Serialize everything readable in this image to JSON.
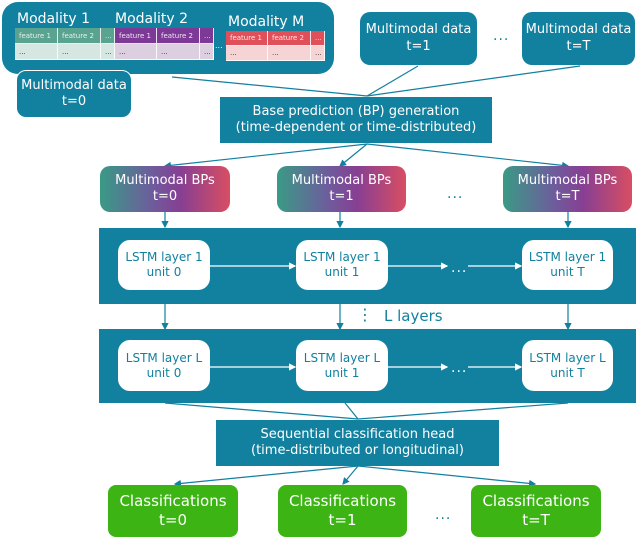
{
  "modality_panel": {
    "modalities": [
      {
        "title": "Modality 1",
        "features": [
          "feature 1",
          "feature 2",
          "..."
        ],
        "row": [
          "...",
          "...",
          "..."
        ],
        "color": "#5aa390"
      },
      {
        "title": "Modality 2",
        "features": [
          "feature 1",
          "feature 2",
          "..."
        ],
        "row": [
          "...",
          "...",
          "..."
        ],
        "color": "#7c3a96"
      },
      {
        "title": "Modality M",
        "features": [
          "feature 1",
          "feature 2",
          "..."
        ],
        "row": [
          "...",
          "...",
          "..."
        ],
        "color": "#e0505a"
      }
    ],
    "between_ellipsis": "..."
  },
  "inputs": [
    {
      "line1": "Multimodal data",
      "line2": "t=0"
    },
    {
      "line1": "Multimodal data",
      "line2": "t=1"
    },
    {
      "line1": "Multimodal data",
      "line2": "t=T"
    }
  ],
  "inputs_ellipsis": "...",
  "bp_generation": {
    "line1": "Base prediction (BP) generation",
    "line2": "(time-dependent or time-distributed)"
  },
  "multimodal_bps": [
    {
      "line1": "Multimodal BPs",
      "line2": "t=0"
    },
    {
      "line1": "Multimodal BPs",
      "line2": "t=1"
    },
    {
      "line1": "Multimodal BPs",
      "line2": "t=T"
    }
  ],
  "bps_ellipsis": "...",
  "lstm_layer_1": [
    {
      "line1": "LSTM layer 1",
      "line2": "unit 0"
    },
    {
      "line1": "LSTM layer 1",
      "line2": "unit 1"
    },
    {
      "line1": "LSTM layer 1",
      "line2": "unit T"
    }
  ],
  "lstm_layer_L": [
    {
      "line1": "LSTM layer L",
      "line2": "unit 0"
    },
    {
      "line1": "LSTM layer L",
      "line2": "unit 1"
    },
    {
      "line1": "LSTM layer L",
      "line2": "unit T"
    }
  ],
  "lstm_ellipsis": "...",
  "layers_label": {
    "vdots": "⋮",
    "text": "L layers"
  },
  "classification_head": {
    "line1": "Sequential classification head",
    "line2": "(time-distributed or longitudinal)"
  },
  "classifications": [
    {
      "line1": "Classifications",
      "line2": "t=0"
    },
    {
      "line1": "Classifications",
      "line2": "t=1"
    },
    {
      "line1": "Classifications",
      "line2": "t=T"
    }
  ],
  "classifications_ellipsis": "...",
  "colors": {
    "teal": "#12809f",
    "green": "#3cb414",
    "lstm_unit_bg": "#ffffff"
  }
}
